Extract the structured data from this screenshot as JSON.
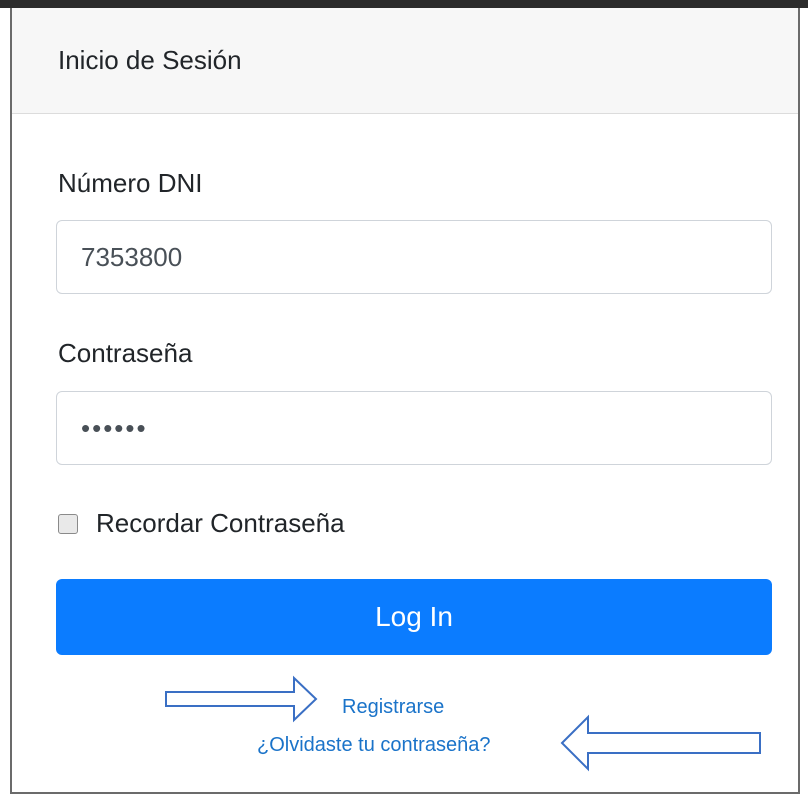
{
  "header": {
    "title": "Inicio de Sesión"
  },
  "form": {
    "dni_label": "Número DNI",
    "dni_value": "7353800",
    "password_label": "Contraseña",
    "password_value": "••••••",
    "remember_label": "Recordar Contraseña",
    "remember_checked": false,
    "login_label": "Log In"
  },
  "links": {
    "register": "Registrarse",
    "forgot": "¿Olvidaste tu contraseña?"
  },
  "colors": {
    "primary": "#0b7cff",
    "link": "#1a73c9",
    "annotation_arrow": "#3a6fc4"
  },
  "annotations": {
    "arrows": [
      "arrow-right-icon",
      "arrow-left-icon"
    ]
  }
}
